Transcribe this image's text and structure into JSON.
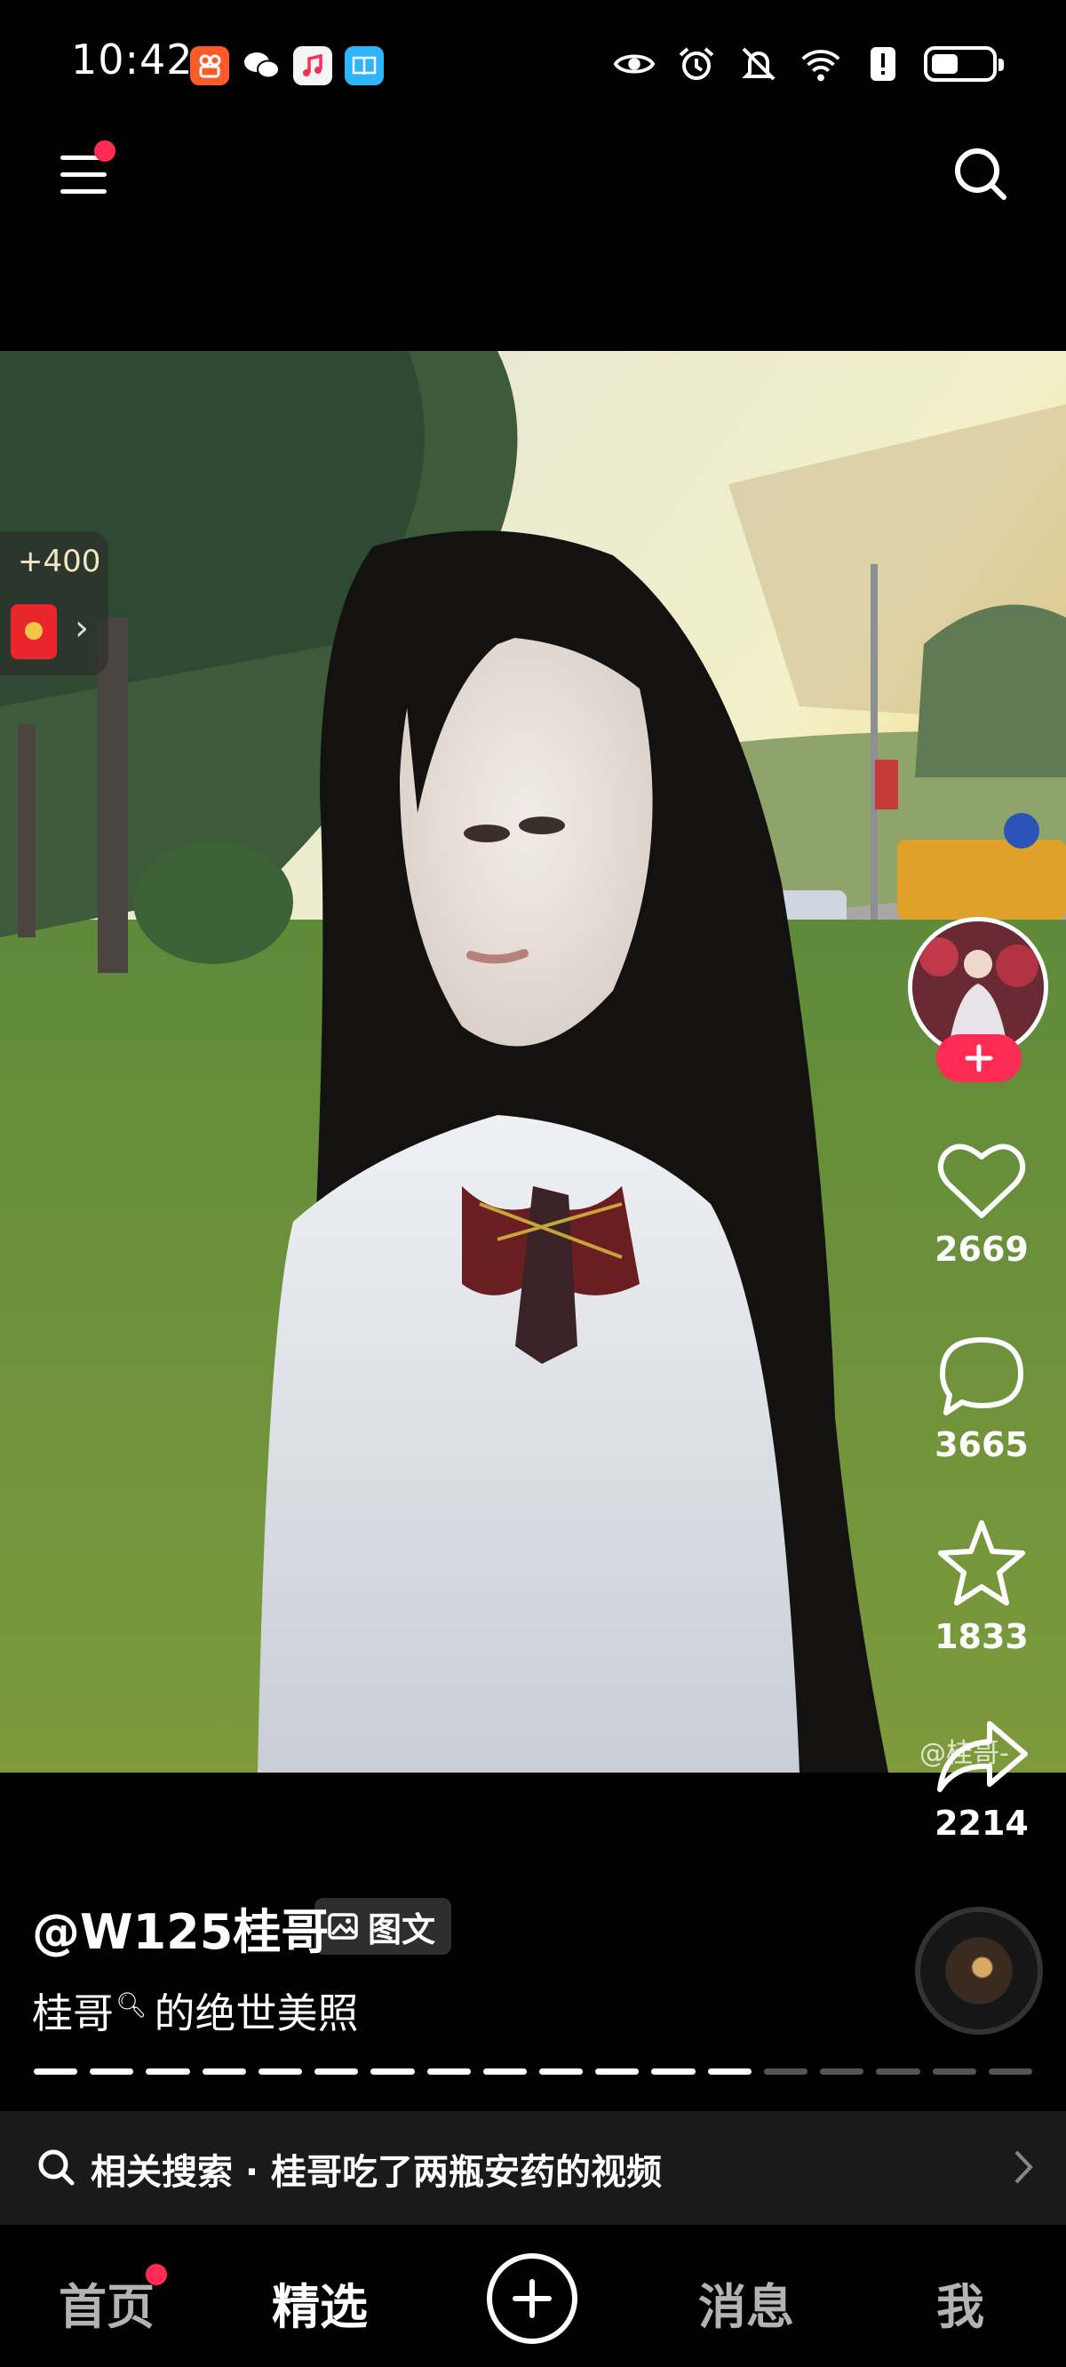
{
  "status_bar": {
    "time": "10:42",
    "app_icons": [
      "kuaishou-icon",
      "wechat-icon",
      "music-icon",
      "reader-icon"
    ],
    "system_icons": [
      "eye-icon",
      "alarm-icon",
      "mute-icon",
      "wifi-icon",
      "alert-icon",
      "battery-icon"
    ],
    "battery_level": 0.45
  },
  "top_nav": {
    "menu_has_notification": true,
    "icons": [
      "menu-icon",
      "search-icon"
    ]
  },
  "reward": {
    "amount": "+400"
  },
  "actions": {
    "like_count": "2669",
    "comment_count": "3665",
    "favorite_count": "1833",
    "share_count": "2214"
  },
  "watermark": "@桂哥-",
  "post": {
    "author": "@W125桂哥",
    "type_label": "图文",
    "caption_name": "桂哥",
    "caption_rest": "的绝世美照",
    "progress_total": 18,
    "progress_current": 13
  },
  "related": {
    "text": "相关搜索 · 桂哥吃了两瓶安药的视频"
  },
  "bottom_nav": {
    "tabs": [
      "首页",
      "精选",
      "消息",
      "我"
    ],
    "active_tab": "精选"
  },
  "colors": {
    "accent": "#fe2c55",
    "background": "#000000"
  }
}
